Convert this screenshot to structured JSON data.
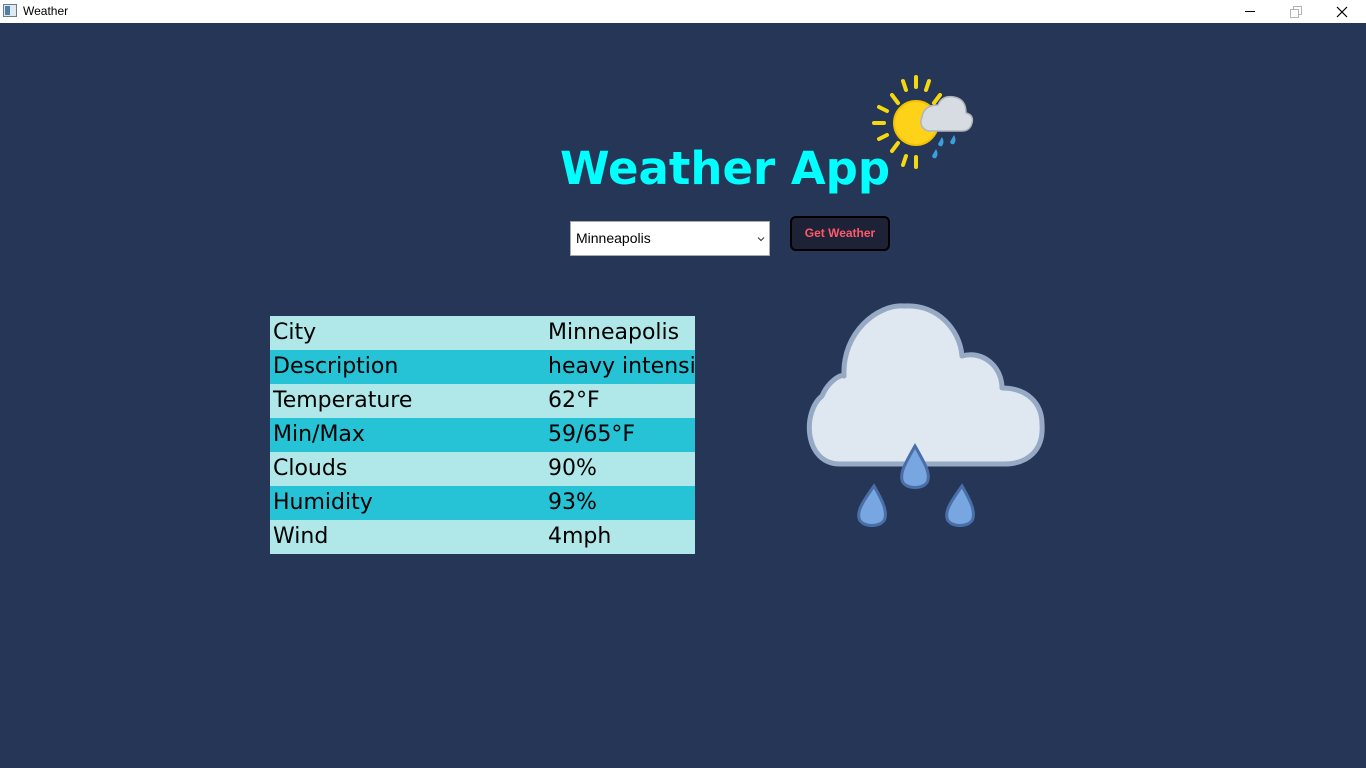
{
  "window": {
    "title": "Weather",
    "controls": [
      "minimize-icon",
      "maximize-icon",
      "close-icon"
    ]
  },
  "header": {
    "title": "Weather App",
    "logo_icon": "sun-cloud-rain-icon"
  },
  "controls": {
    "city_selected": "Minneapolis",
    "get_weather_label": "Get Weather"
  },
  "weather_table": {
    "rows": [
      {
        "label": "City",
        "value": "Minneapolis"
      },
      {
        "label": "Description",
        "value": "heavy intensity"
      },
      {
        "label": "Temperature",
        "value": "62°F"
      },
      {
        "label": "Min/Max",
        "value": "59/65°F"
      },
      {
        "label": "Clouds",
        "value": "90%"
      },
      {
        "label": "Humidity",
        "value": "93%"
      },
      {
        "label": "Wind",
        "value": "4mph"
      }
    ]
  },
  "weather_icon": "cloud-rain-icon",
  "colors": {
    "background": "#263657",
    "title": "#00ffff",
    "row_light": "#b0e8ea",
    "row_dark": "#26c2d5",
    "button_bg": "#1d2236",
    "button_text": "#ff5a6a"
  }
}
